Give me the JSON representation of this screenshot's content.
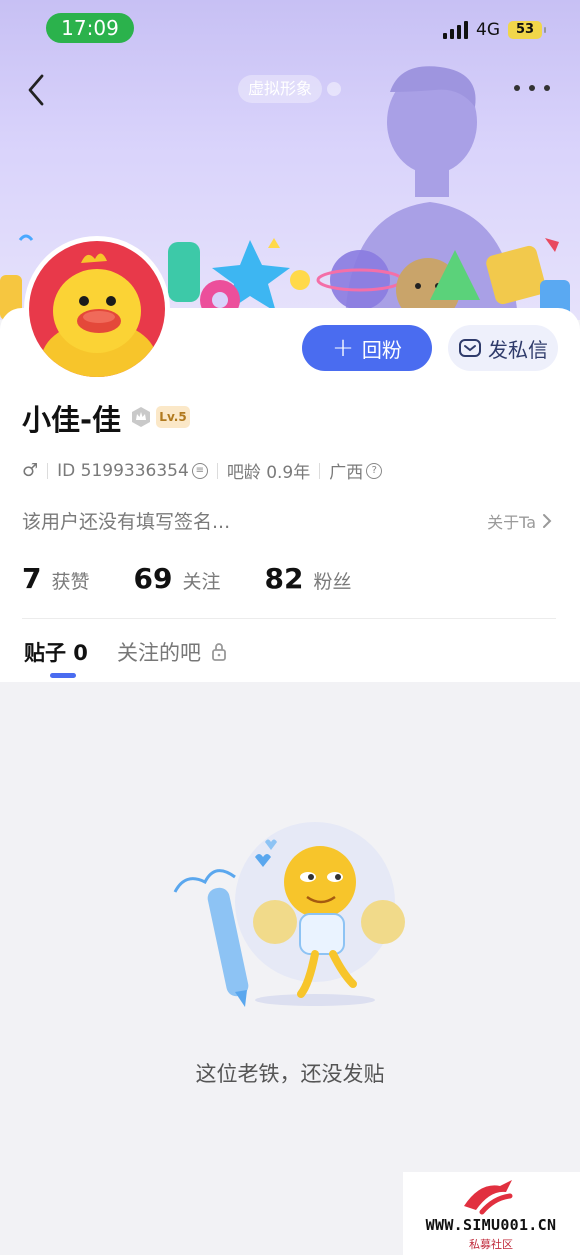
{
  "status_bar": {
    "time": "17:09",
    "network": "4G",
    "battery": "53"
  },
  "header": {
    "avatar_tag": "虚拟形象"
  },
  "actions": {
    "follow_label": "回粉",
    "message_label": "发私信"
  },
  "profile": {
    "username": "小佳-佳",
    "level": "Lv.5",
    "id_text": "ID 5199336354",
    "bar_age": "吧龄 0.9年",
    "location": "广西",
    "signature": "该用户还没有填写签名...",
    "about_link": "关于Ta"
  },
  "stats": [
    {
      "value": "7",
      "label": "获赞"
    },
    {
      "value": "69",
      "label": "关注"
    },
    {
      "value": "82",
      "label": "粉丝"
    }
  ],
  "tabs": {
    "posts": "贴子 0",
    "followed_bars": "关注的吧"
  },
  "empty_state": {
    "message": "这位老铁，还没发贴"
  },
  "watermark": {
    "site": "WWW.SIMU001.CN",
    "sub": "私募社区"
  },
  "colors": {
    "accent": "#4a6cf0",
    "status_green": "#2bb24c",
    "avatar_bg": "#e8394a"
  }
}
